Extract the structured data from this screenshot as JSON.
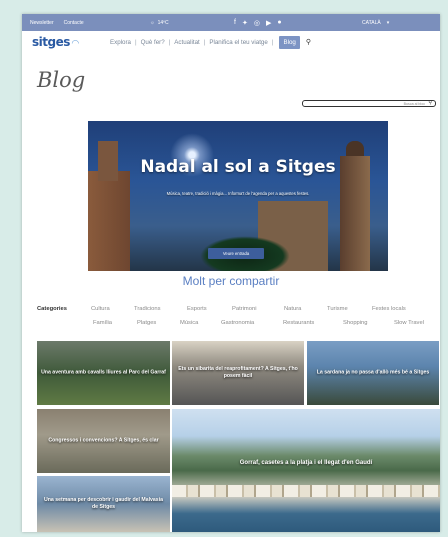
{
  "topbar": {
    "newsletter": "Newsletter",
    "contact": "Contacte",
    "weather": "14ºC",
    "language": "CATALÀ",
    "social_icons": [
      "facebook-icon",
      "twitter-icon",
      "instagram-icon",
      "youtube-icon",
      "flickr-icon"
    ]
  },
  "nav": {
    "logo": "sitges",
    "items": [
      "Explora",
      "Què fer?",
      "Actualitat",
      "Planifica el teu viatge"
    ],
    "active": "Blog"
  },
  "blog": {
    "title": "Blog",
    "search_placeholder": "Busca al bloc"
  },
  "hero": {
    "title": "Nadal al sol a Sitges",
    "subtitle": "Música, teatre, tradició i màgia... Informa't de l'agenda per a aquestes festes.",
    "button": "Veure entrada"
  },
  "section_title": "Molt per compartir",
  "categories": {
    "label": "Categories",
    "row1": [
      "Cultura",
      "Tradicions",
      "Esports",
      "Patrimoni",
      "Natura",
      "Turisme",
      "Festes locals"
    ],
    "row2": [
      "Família",
      "Platges",
      "Música",
      "Gastronomia",
      "Restaurants",
      "Shopping",
      "Slow Travel"
    ]
  },
  "posts": [
    "Una aventura amb cavalls lliures al Parc del Garraf",
    "Ets un sibarita del reaprofitament? A Sitges, t'ho posem fàcil",
    "La sardana ja no passa d'allò més bé a Sitges",
    "Congressos i convencions? A Sitges, és clar",
    "Gorraf, casetes a la platja i el llegat d'en Gaudí",
    "Una setmana per descobrir i gaudir del Malvasia de Sitges"
  ],
  "colors": {
    "accent": "#7b8fbc",
    "link": "#5a7fc2",
    "background": "#d8ece8"
  }
}
